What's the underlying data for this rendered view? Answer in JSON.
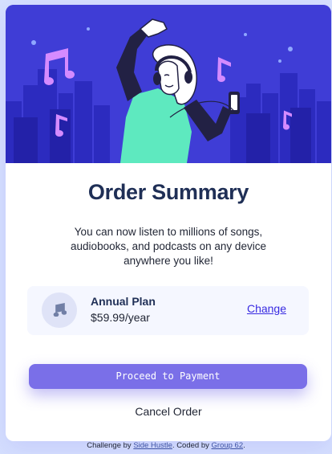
{
  "hero": {
    "illustration": "person-with-headphones-dancing-city-music-notes"
  },
  "summary": {
    "title": "Order Summary",
    "description": "You can now listen to millions of songs, audiobooks, and podcasts on any device anywhere you like!"
  },
  "plan": {
    "icon": "music-note-icon",
    "name": "Annual Plan",
    "price": "$59.99/year",
    "change_label": "Change"
  },
  "actions": {
    "proceed_label": "Proceed to Payment",
    "cancel_label": "Cancel Order"
  },
  "attribution": {
    "prefix": "Challenge by",
    "challenge_link": "Side Hustle",
    "middle": ". Coded by",
    "coder_link": "Group 62",
    "suffix": "."
  },
  "colors": {
    "page_background": "#d6e0fe",
    "hero_background": "#3f3dd6",
    "primary_button": "#7a6fe8",
    "link": "#382ae1",
    "title_text": "#1f2f56"
  }
}
